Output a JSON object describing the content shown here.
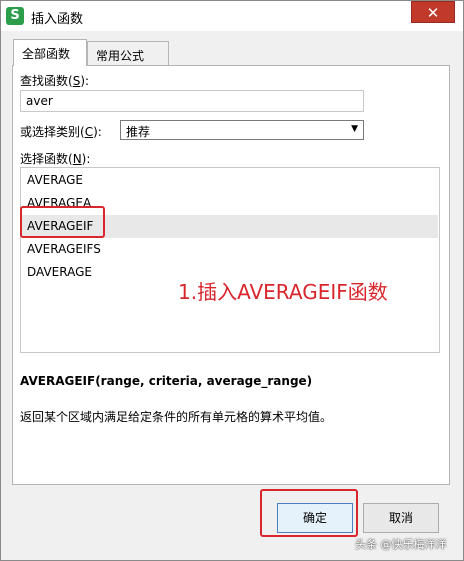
{
  "window": {
    "title": "插入函数",
    "app_icon": "S",
    "close_glyph": "✕"
  },
  "tabs": [
    {
      "label": "全部函数",
      "active": true
    },
    {
      "label": "常用公式",
      "active": false
    }
  ],
  "search": {
    "label_prefix": "查找函数(",
    "label_key": "S",
    "label_suffix": "):",
    "value": "aver"
  },
  "category": {
    "label_prefix": "或选择类别(",
    "label_key": "C",
    "label_suffix": "):",
    "selected": "推荐"
  },
  "function_list": {
    "label_prefix": "选择函数(",
    "label_key": "N",
    "label_suffix": "):",
    "items": [
      "AVERAGE",
      "AVERAGEA",
      "AVERAGEIF",
      "AVERAGEIFS",
      "DAVERAGE"
    ],
    "selected_index": 2
  },
  "annotation": {
    "text": "1.插入AVERAGEIF函数",
    "color": "#d9262c"
  },
  "details": {
    "signature": "AVERAGEIF(range, criteria, average_range)",
    "description": "返回某个区域内满足给定条件的所有单元格的算术平均值。"
  },
  "buttons": {
    "ok": "确定",
    "cancel": "取消"
  },
  "watermark": "头条 @快乐梅洋洋"
}
